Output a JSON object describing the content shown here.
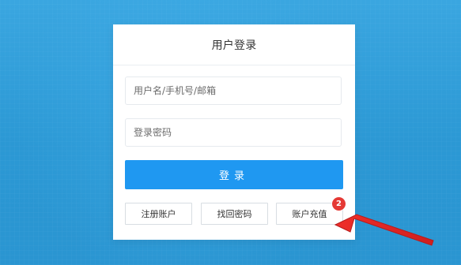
{
  "login": {
    "title": "用户登录",
    "username_placeholder": "用户名/手机号/邮箱",
    "password_placeholder": "登录密码",
    "submit_label": "登录",
    "register_label": "注册账户",
    "recover_label": "找回密码",
    "recharge_label": "账户充值"
  },
  "annotation": {
    "step_number": "2"
  },
  "colors": {
    "background": "#2e9ed9",
    "primary_button": "#1f98f1",
    "annotation_red": "#e53935"
  }
}
